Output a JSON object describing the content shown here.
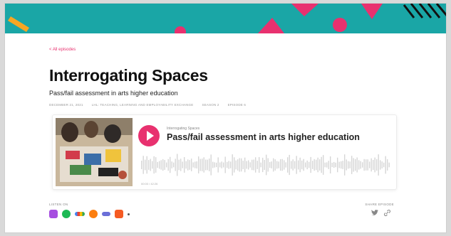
{
  "nav": {
    "back_label": "< All episodes"
  },
  "episode": {
    "title": "Interrogating Spaces",
    "subtitle": "Pass/fail assessment in arts higher education",
    "meta": [
      "December 21, 2021",
      "LHL: Teaching, Learning and Employability Exchange",
      "Season 2",
      "Episode 6"
    ]
  },
  "player": {
    "show_name": "Interrogating Spaces",
    "episode_title": "Pass/fail assessment in arts higher education",
    "time": "00:00 / 42:26",
    "accent_color": "#e8316f"
  },
  "listen": {
    "label": "LISTEN ON",
    "platforms": [
      "apple-podcasts-icon",
      "spotify-icon",
      "google-podcasts-icon",
      "overcast-icon",
      "pocket-casts-icon",
      "castbox-icon",
      "more-icon"
    ]
  },
  "share": {
    "label": "SHARE EPISODE",
    "icons": [
      "twitter-icon",
      "link-icon"
    ]
  },
  "colors": {
    "banner": "#1aa6a6",
    "accent": "#e8316f"
  }
}
